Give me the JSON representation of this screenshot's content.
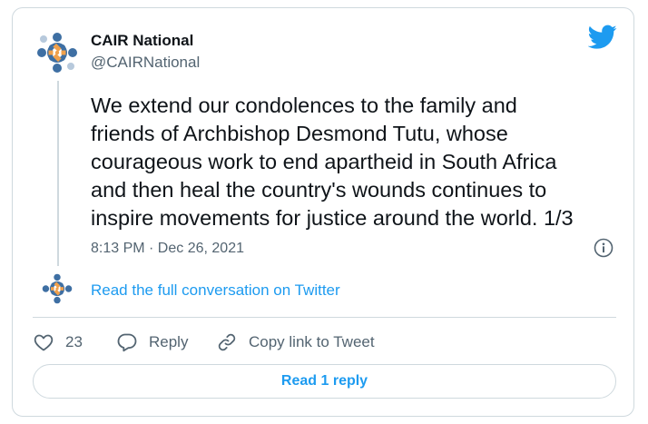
{
  "author": {
    "display_name": "CAIR National",
    "handle": "@CAIRNational",
    "avatar": "cair-logo-avatar"
  },
  "tweet": {
    "text_lines": [
      "We extend our condolences to the family and",
      "friends of Archbishop Desmond Tutu, whose",
      "courageous work to end apartheid in South Africa",
      "and then heal the country's wounds continues to",
      "inspire movements for justice around the world. 1/3"
    ],
    "timestamp": "8:13 PM · Dec 26, 2021"
  },
  "conversation_link": "Read the full conversation on Twitter",
  "actions": {
    "like_count": "23",
    "reply_label": "Reply",
    "copy_label": "Copy link to Tweet"
  },
  "read_reply_label": "Read 1 reply",
  "icons": {
    "brand": "twitter-bird-icon",
    "info": "info-icon",
    "like": "heart-icon",
    "reply": "speech-bubble-icon",
    "copy": "link-icon"
  },
  "colors": {
    "accent": "#1d9bf0",
    "text_primary": "#0f1419",
    "text_secondary": "#536471",
    "border": "#cfd9de",
    "logo_blue": "#3e6fa3",
    "logo_orange": "#f0a04b"
  }
}
